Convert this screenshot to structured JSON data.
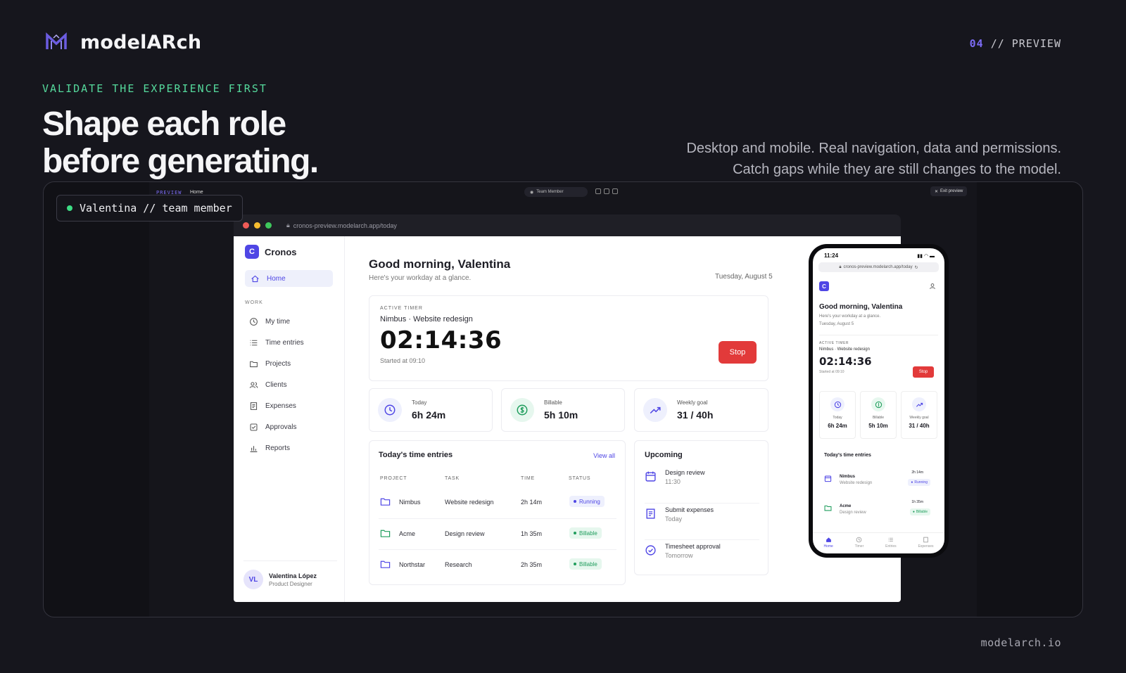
{
  "brand": {
    "name": "modelARch"
  },
  "slide": {
    "number": "04",
    "separator": "//",
    "label": "PREVIEW"
  },
  "eyebrow": "VALIDATE THE EXPERIENCE FIRST",
  "headline": {
    "line1": "Shape each role",
    "line2": "before generating."
  },
  "subhead": {
    "line1": "Desktop and mobile. Real navigation, data and permissions.",
    "line2": "Catch gaps while they are still changes to the model."
  },
  "footer": "modelarch.io",
  "preview": {
    "role_chip": "Valentina // team member",
    "topbar": {
      "label": "PREVIEW",
      "page": "Home",
      "role": "Team Member",
      "exit": "Exit preview"
    }
  },
  "desktop": {
    "url": "cronos-preview.modelarch.app/today",
    "app_name": "Cronos",
    "app_badge": "C",
    "nav_home": "Home",
    "nav_section": "WORK",
    "nav_items": [
      "My time",
      "Time entries",
      "Projects",
      "Clients",
      "Expenses",
      "Approvals",
      "Reports"
    ],
    "user": {
      "initials": "VL",
      "name": "Valentina López",
      "role": "Product Designer"
    },
    "greeting": "Good morning, Valentina",
    "greeting_sub": "Here's your workday at a glance.",
    "date": "Tuesday, August 5",
    "timer": {
      "label": "ACTIVE TIMER",
      "project": "Nimbus",
      "sep": "·",
      "task": "Website redesign",
      "time": "02:14:36",
      "started": "Started at 09:10",
      "stop": "Stop"
    },
    "stats": [
      {
        "label": "Today",
        "value": "6h 24m"
      },
      {
        "label": "Billable",
        "value": "5h 10m"
      },
      {
        "label": "Weekly goal",
        "value": "31 / 40h"
      }
    ],
    "entries": {
      "title": "Today's time entries",
      "view_all": "View all",
      "columns": [
        "PROJECT",
        "TASK",
        "TIME",
        "STATUS"
      ],
      "rows": [
        {
          "project": "Nimbus",
          "task": "Website redesign",
          "time": "2h 14m",
          "status": "Running"
        },
        {
          "project": "Acme",
          "task": "Design review",
          "time": "1h 35m",
          "status": "Billable"
        },
        {
          "project": "Northstar",
          "task": "Research",
          "time": "2h 35m",
          "status": "Billable"
        }
      ]
    },
    "upcoming": {
      "title": "Upcoming",
      "items": [
        {
          "title": "Design review",
          "sub": "11:30"
        },
        {
          "title": "Submit expenses",
          "sub": "Today"
        },
        {
          "title": "Timesheet approval",
          "sub": "Tomorrow"
        }
      ]
    }
  },
  "mobile": {
    "time": "11:24",
    "url": "cronos-preview.modelarch.app/today",
    "badge": "C",
    "greeting": "Good morning, Valentina",
    "sub": "Here's your workday at a glance.",
    "date": "Tuesday, August 5",
    "timer": {
      "label": "ACTIVE TIMER",
      "project": "Nimbus · Website redesign",
      "time": "02:14:36",
      "started": "Started at 09:10",
      "stop": "Stop"
    },
    "stats": [
      {
        "label": "Today",
        "value": "6h 24m"
      },
      {
        "label": "Billable",
        "value": "5h 10m"
      },
      {
        "label": "Weekly goal",
        "value": "31 / 40h"
      }
    ],
    "entries_title": "Today's time entries",
    "entries": [
      {
        "project": "Nimbus",
        "task": "Website redesign",
        "time": "2h 14m",
        "status": "Running"
      },
      {
        "project": "Acme",
        "task": "Design review",
        "time": "1h 35m",
        "status": "Billable"
      }
    ],
    "tabs": [
      "Home",
      "Timer",
      "Entries",
      "Expenses"
    ]
  },
  "colors": {
    "accent": "#4f46e5",
    "eyebrow": "#55d99c",
    "stop": "#e23a3a",
    "running_bg": "#eef0fd",
    "billable_bg": "#e6f7ee"
  }
}
